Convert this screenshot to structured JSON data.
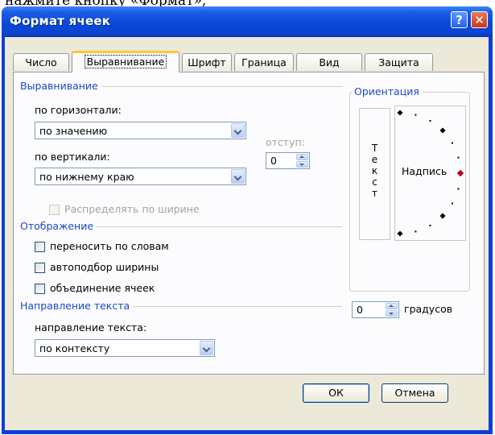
{
  "behind_text": "нажми́те кнопку «Формат»,",
  "window": {
    "title": "Формат ячеек"
  },
  "titlebar": {
    "help_glyph": "?",
    "close_glyph": "✕"
  },
  "tabs": [
    {
      "label": "Число",
      "active": false
    },
    {
      "label": "Выравнивание",
      "active": true
    },
    {
      "label": "Шрифт",
      "active": false
    },
    {
      "label": "Граница",
      "active": false
    },
    {
      "label": "Вид",
      "active": false
    },
    {
      "label": "Защита",
      "active": false
    }
  ],
  "alignment": {
    "group_label": "Выравнивание",
    "horizontal_label": "по горизонтали:",
    "horizontal_value": "по значению",
    "vertical_label": "по вертикали:",
    "vertical_value": "по нижнему краю",
    "indent_label": "отступ:",
    "indent_value": "0",
    "distribute_label": "Распределять по ширине"
  },
  "display": {
    "group_label": "Отображение",
    "wrap_label": "переносить по словам",
    "shrink_label": "автоподбор ширины",
    "merge_label": "объединение ячеек"
  },
  "direction": {
    "group_label": "Направление текста",
    "direction_label": "направление текста:",
    "direction_value": "по контексту"
  },
  "orientation": {
    "group_label": "Ориентация",
    "vertical_text": [
      "Т",
      "е",
      "к",
      "с",
      "т"
    ],
    "dial_label": "Надпись",
    "degrees_value": "0",
    "degrees_label": "градусов",
    "angle_degrees": 0
  },
  "buttons": {
    "ok": "ОК",
    "cancel": "Отмена"
  },
  "colors": {
    "titlebar": "#0a48d8",
    "group_label": "#1c49c6",
    "dial_marker": "#c0001a",
    "tab_highlight": "#ffc83c"
  }
}
